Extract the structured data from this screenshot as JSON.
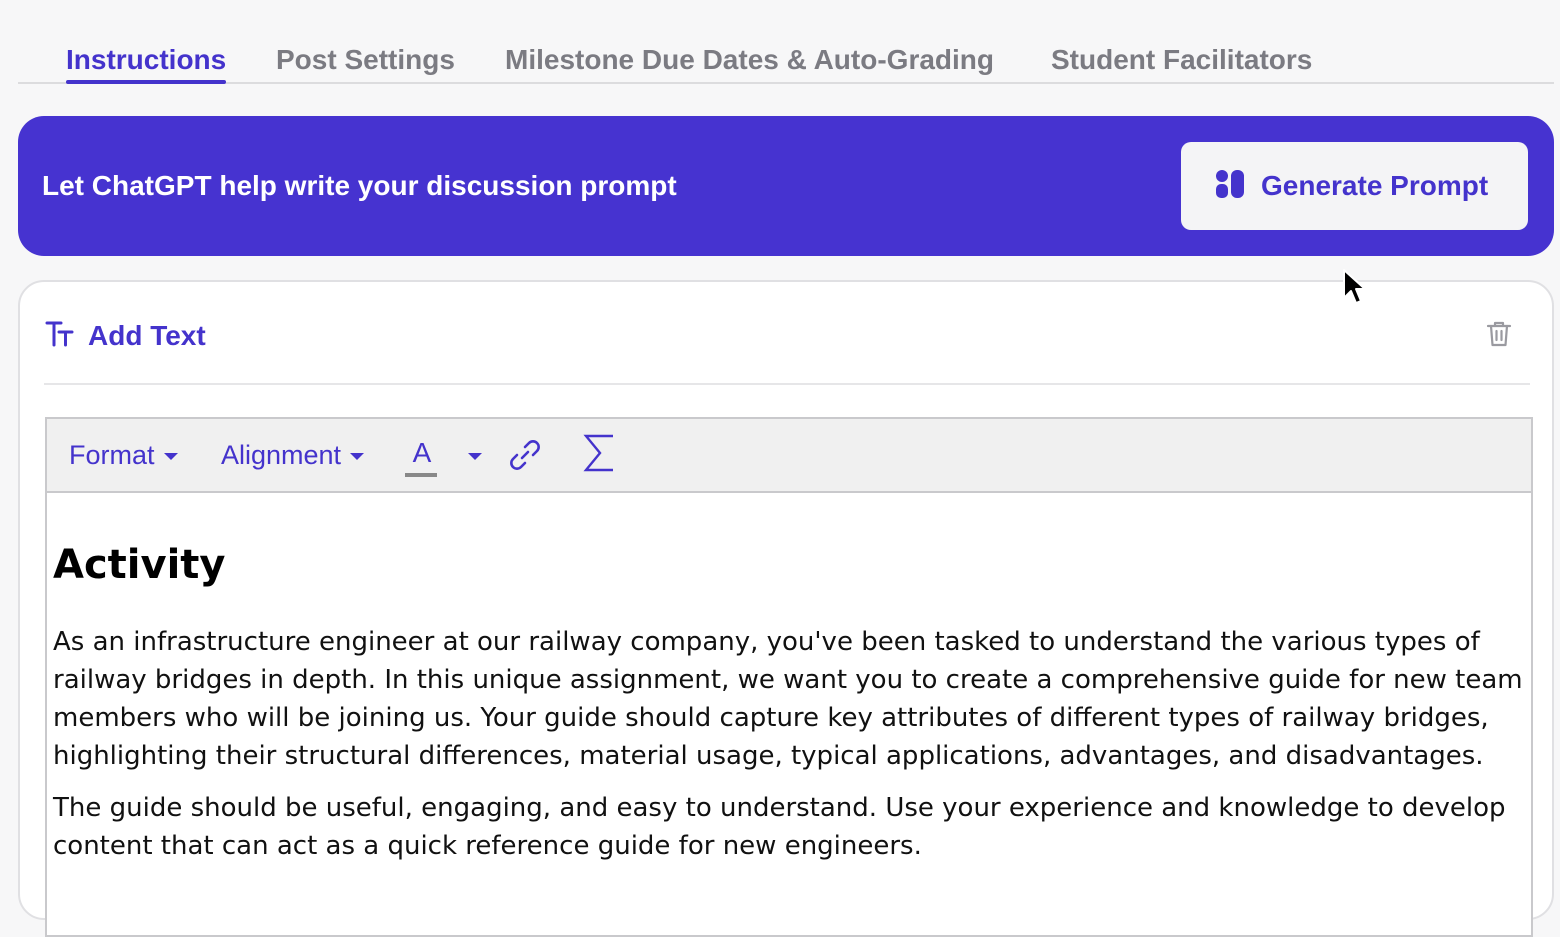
{
  "tabs": [
    {
      "label": "Instructions",
      "active": true
    },
    {
      "label": "Post Settings",
      "active": false
    },
    {
      "label": "Milestone Due Dates & Auto-Grading",
      "active": false
    },
    {
      "label": "Student Facilitators",
      "active": false
    }
  ],
  "banner": {
    "text": "Let ChatGPT help write your discussion prompt",
    "button_label": "Generate Prompt",
    "button_icon": "chatgpt-blocks-icon",
    "background_color": "#4633d0"
  },
  "card": {
    "title": "Add Text",
    "title_icon": "text-type-icon",
    "delete_icon": "trash-icon"
  },
  "toolbar": {
    "format_label": "Format",
    "alignment_label": "Alignment",
    "font_color_label": "A",
    "link_icon": "link-icon",
    "equation_icon": "sigma-icon"
  },
  "content": {
    "heading": "Activity",
    "paragraphs": [
      "As an infrastructure engineer at our railway company, you've been tasked to understand the various types of railway bridges in depth. In this unique assignment, we want you to create a comprehensive guide for new team members who will be joining us. Your guide should capture key attributes of different types of railway bridges, highlighting their structural differences, material usage, typical applications, advantages, and disadvantages.",
      "The guide should be useful, engaging, and easy to understand. Use your experience and knowledge to develop content that can act as a quick reference guide for new engineers."
    ]
  },
  "colors": {
    "accent": "#4433cc",
    "tab_inactive": "#7b7b82"
  }
}
